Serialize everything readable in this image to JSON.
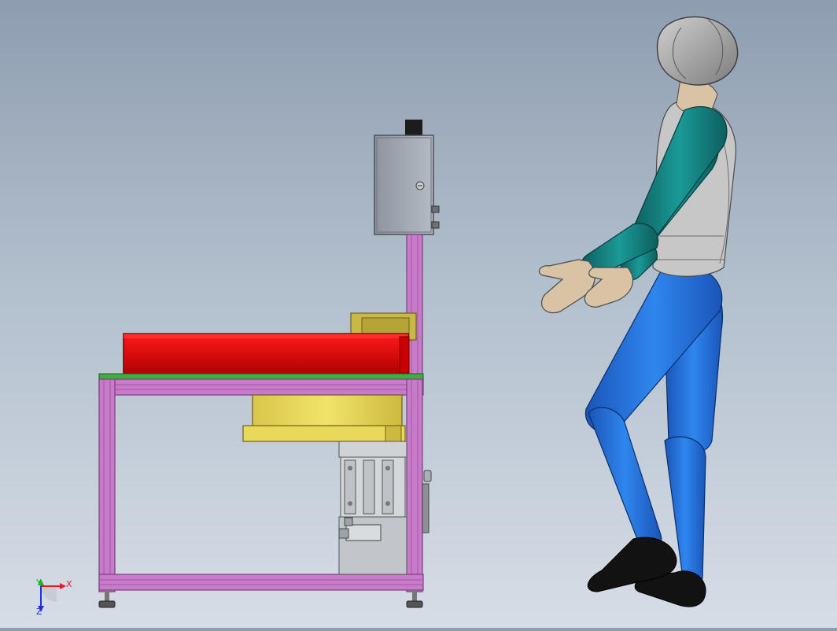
{
  "viewport": {
    "name": "cad-3d-viewport",
    "background_top": "#8e9db0",
    "background_bottom": "#d6dde6"
  },
  "triad": {
    "x_label": "X",
    "y_label": "Y",
    "z_label": "Z",
    "x_color": "#e02020",
    "y_color": "#20b020",
    "z_color": "#2030e0"
  },
  "colors": {
    "frame": "#c77bc9",
    "frame_dark": "#8a4a8c",
    "tabletop": "#3fae3f",
    "bowl": "#d90000",
    "feeder_base": "#e6d44d",
    "enclosure": "#9aa1ad",
    "mannequin_head": "#a9a9a9",
    "mannequin_arm": "#117a7a",
    "mannequin_leg": "#1f6fd6",
    "mannequin_torso": "#c7c7c7",
    "mannequin_skin": "#d8c3a5",
    "shoe": "#111111"
  }
}
